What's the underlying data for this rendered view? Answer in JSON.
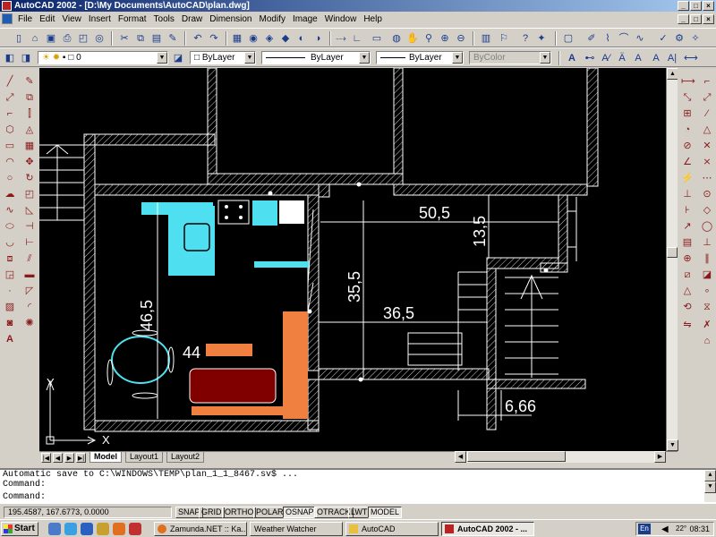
{
  "window": {
    "title": "AutoCAD 2002 - [D:\\My Documents\\AutoCAD\\plan.dwg]"
  },
  "menu": [
    "File",
    "Edit",
    "View",
    "Insert",
    "Format",
    "Tools",
    "Draw",
    "Dimension",
    "Modify",
    "Image",
    "Window",
    "Help"
  ],
  "properties_bar": {
    "layer_value": "0",
    "color_value": "ByLayer",
    "linetype_value": "ByLayer",
    "lineweight_value": "ByLayer",
    "plotstyle_value": "ByColor"
  },
  "drawing": {
    "dimensions": [
      "50,5",
      "13,5",
      "35,5",
      "36,5",
      "46,5",
      "44",
      "6,66"
    ],
    "ucs_x_label": "X",
    "ucs_y_label": "Y",
    "colors": {
      "background": "#000000",
      "walls": "#ffffff",
      "cyan_fixtures": "#4ee0f0",
      "orange_furniture": "#f08040",
      "dark_red_bed": "#800000"
    }
  },
  "layout_tabs": [
    "Model",
    "Layout1",
    "Layout2"
  ],
  "command": {
    "history": [
      "Automatic save to C:\\WINDOWS\\TEMP\\plan_1_1_8467.sv$ ...",
      "Command:"
    ],
    "prompt": "Command:"
  },
  "status": {
    "coordinates": "195.4587, 167.6773, 0.0000",
    "toggles": [
      "SNAP",
      "GRID",
      "ORTHO",
      "POLAR",
      "OSNAP",
      "OTRACK",
      "LWT",
      "MODEL"
    ]
  },
  "taskbar": {
    "start_label": "Start",
    "tasks": [
      "Zamunda.NET :: Ka...",
      "Weather Watcher",
      "AutoCAD",
      "AutoCAD 2002 - ..."
    ],
    "tray_language": "En",
    "tray_temperature": "22°",
    "clock": "08:31"
  }
}
